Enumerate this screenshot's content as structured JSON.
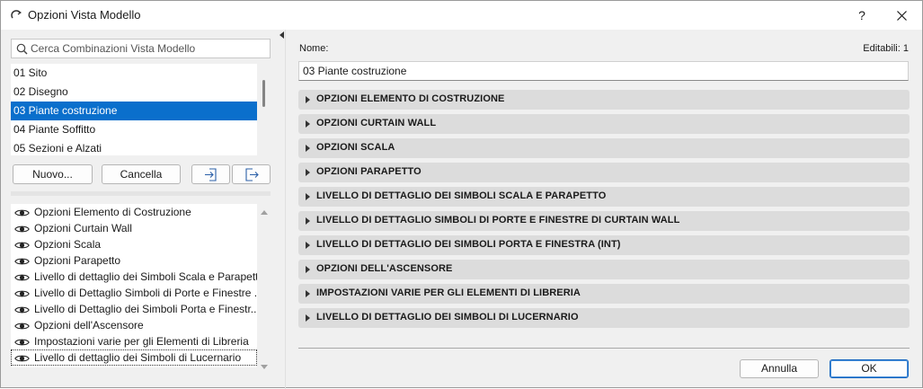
{
  "window": {
    "title": "Opzioni Vista Modello",
    "help_label": "?"
  },
  "search": {
    "placeholder": "Cerca Combinazioni Vista Modello"
  },
  "combinations": [
    {
      "label": "01 Sito",
      "selected": false
    },
    {
      "label": "02 Disegno",
      "selected": false
    },
    {
      "label": "03 Piante costruzione",
      "selected": true
    },
    {
      "label": "04 Piante Soffitto",
      "selected": false
    },
    {
      "label": "05 Sezioni e Alzati",
      "selected": false
    }
  ],
  "buttons": {
    "new_label": "Nuovo...",
    "delete_label": "Cancella",
    "import_icon": "import-icon",
    "export_icon": "export-icon"
  },
  "option_sets": [
    {
      "label": "Opzioni Elemento di Costruzione",
      "icon": "eye-icon"
    },
    {
      "label": "Opzioni Curtain Wall",
      "icon": "eye-icon"
    },
    {
      "label": "Opzioni Scala",
      "icon": "eye-icon"
    },
    {
      "label": "Opzioni Parapetto",
      "icon": "eye-icon"
    },
    {
      "label": "Livello di dettaglio dei Simboli Scala e Parapetto",
      "icon": "eye-icon"
    },
    {
      "label": "Livello di Dettaglio Simboli di Porte e Finestre ...",
      "icon": "eye-icon"
    },
    {
      "label": "Livello di Dettaglio dei Simboli Porta e Finestr...",
      "icon": "eye-icon"
    },
    {
      "label": "Opzioni dell'Ascensore",
      "icon": "eye-icon"
    },
    {
      "label": "Impostazioni varie per gli Elementi di Libreria",
      "icon": "eye-icon"
    },
    {
      "label": "Livello di dettaglio dei Simboli di Lucernario",
      "icon": "eye-icon"
    }
  ],
  "details": {
    "name_label": "Nome:",
    "editable_label": "Editabili: 1",
    "name_value": "03 Piante costruzione"
  },
  "sections": [
    "OPZIONI ELEMENTO DI COSTRUZIONE",
    "OPZIONI CURTAIN WALL",
    "OPZIONI SCALA",
    "OPZIONI PARAPETTO",
    "LIVELLO DI DETTAGLIO DEI SIMBOLI SCALA E PARAPETTO",
    "LIVELLO DI DETTAGLIO SIMBOLI DI PORTE E FINESTRE DI CURTAIN WALL",
    "LIVELLO DI DETTAGLIO DEI SIMBOLI PORTA E FINESTRA (INT)",
    "OPZIONI DELL'ASCENSORE",
    "IMPOSTAZIONI VARIE PER GLI ELEMENTI DI LIBRERIA",
    "LIVELLO DI DETTAGLIO DEI SIMBOLI DI LUCERNARIO"
  ],
  "footer": {
    "cancel_label": "Annulla",
    "ok_label": "OK"
  },
  "colors": {
    "selection": "#0a6fcc",
    "section_bg": "#dcdcdc",
    "dialog_bg": "#f0f0f0"
  }
}
